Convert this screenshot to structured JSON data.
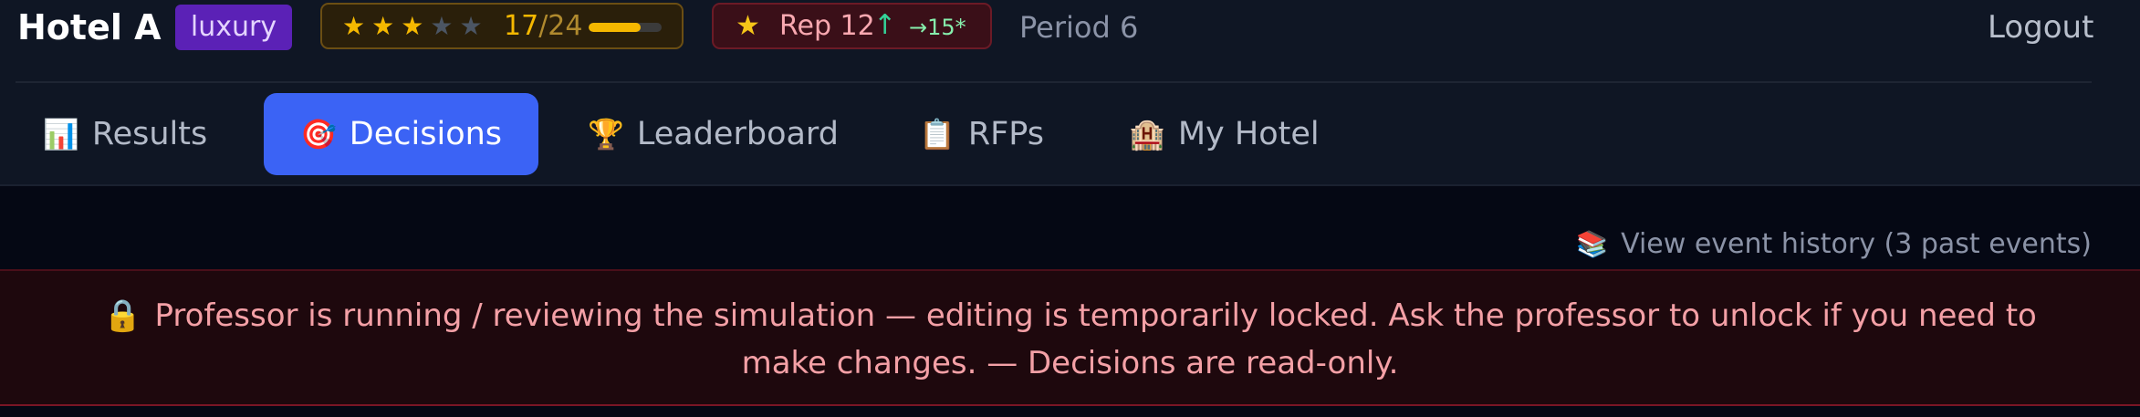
{
  "header": {
    "hotel_name": "Hotel A",
    "hotel_class": "luxury",
    "stars": {
      "filled": 3,
      "total": 5,
      "score": "17",
      "separator": "/",
      "max": "24",
      "progress": 0.708
    },
    "reputation": {
      "icon": "star-icon",
      "label": "Rep 12",
      "trend_icon": "arrow-up-icon",
      "trend": "↑",
      "target": "→15*"
    },
    "period": "Period 6",
    "logout_label": "Logout"
  },
  "tabs": [
    {
      "icon": "📊",
      "label": "Results",
      "active": false
    },
    {
      "icon": "🎯",
      "label": "Decisions",
      "active": true
    },
    {
      "icon": "🏆",
      "label": "Leaderboard",
      "active": false
    },
    {
      "icon": "📋",
      "label": "RFPs",
      "active": false
    },
    {
      "icon": "🏨",
      "label": "My Hotel",
      "active": false
    }
  ],
  "event_history": {
    "icon": "📚",
    "label": "View event history (3 past events)"
  },
  "lock_banner": {
    "icon": "🔒",
    "message": "Professor is running / reviewing the simulation — editing is temporarily locked. Ask the professor to unlock if you need to make changes. — Decisions are read-only."
  },
  "colors": {
    "accent": "#3b63f5",
    "badge": "#5b21b6",
    "star": "#f5b800",
    "danger_bg": "#1e080d",
    "danger_text": "#f4a0a6"
  }
}
